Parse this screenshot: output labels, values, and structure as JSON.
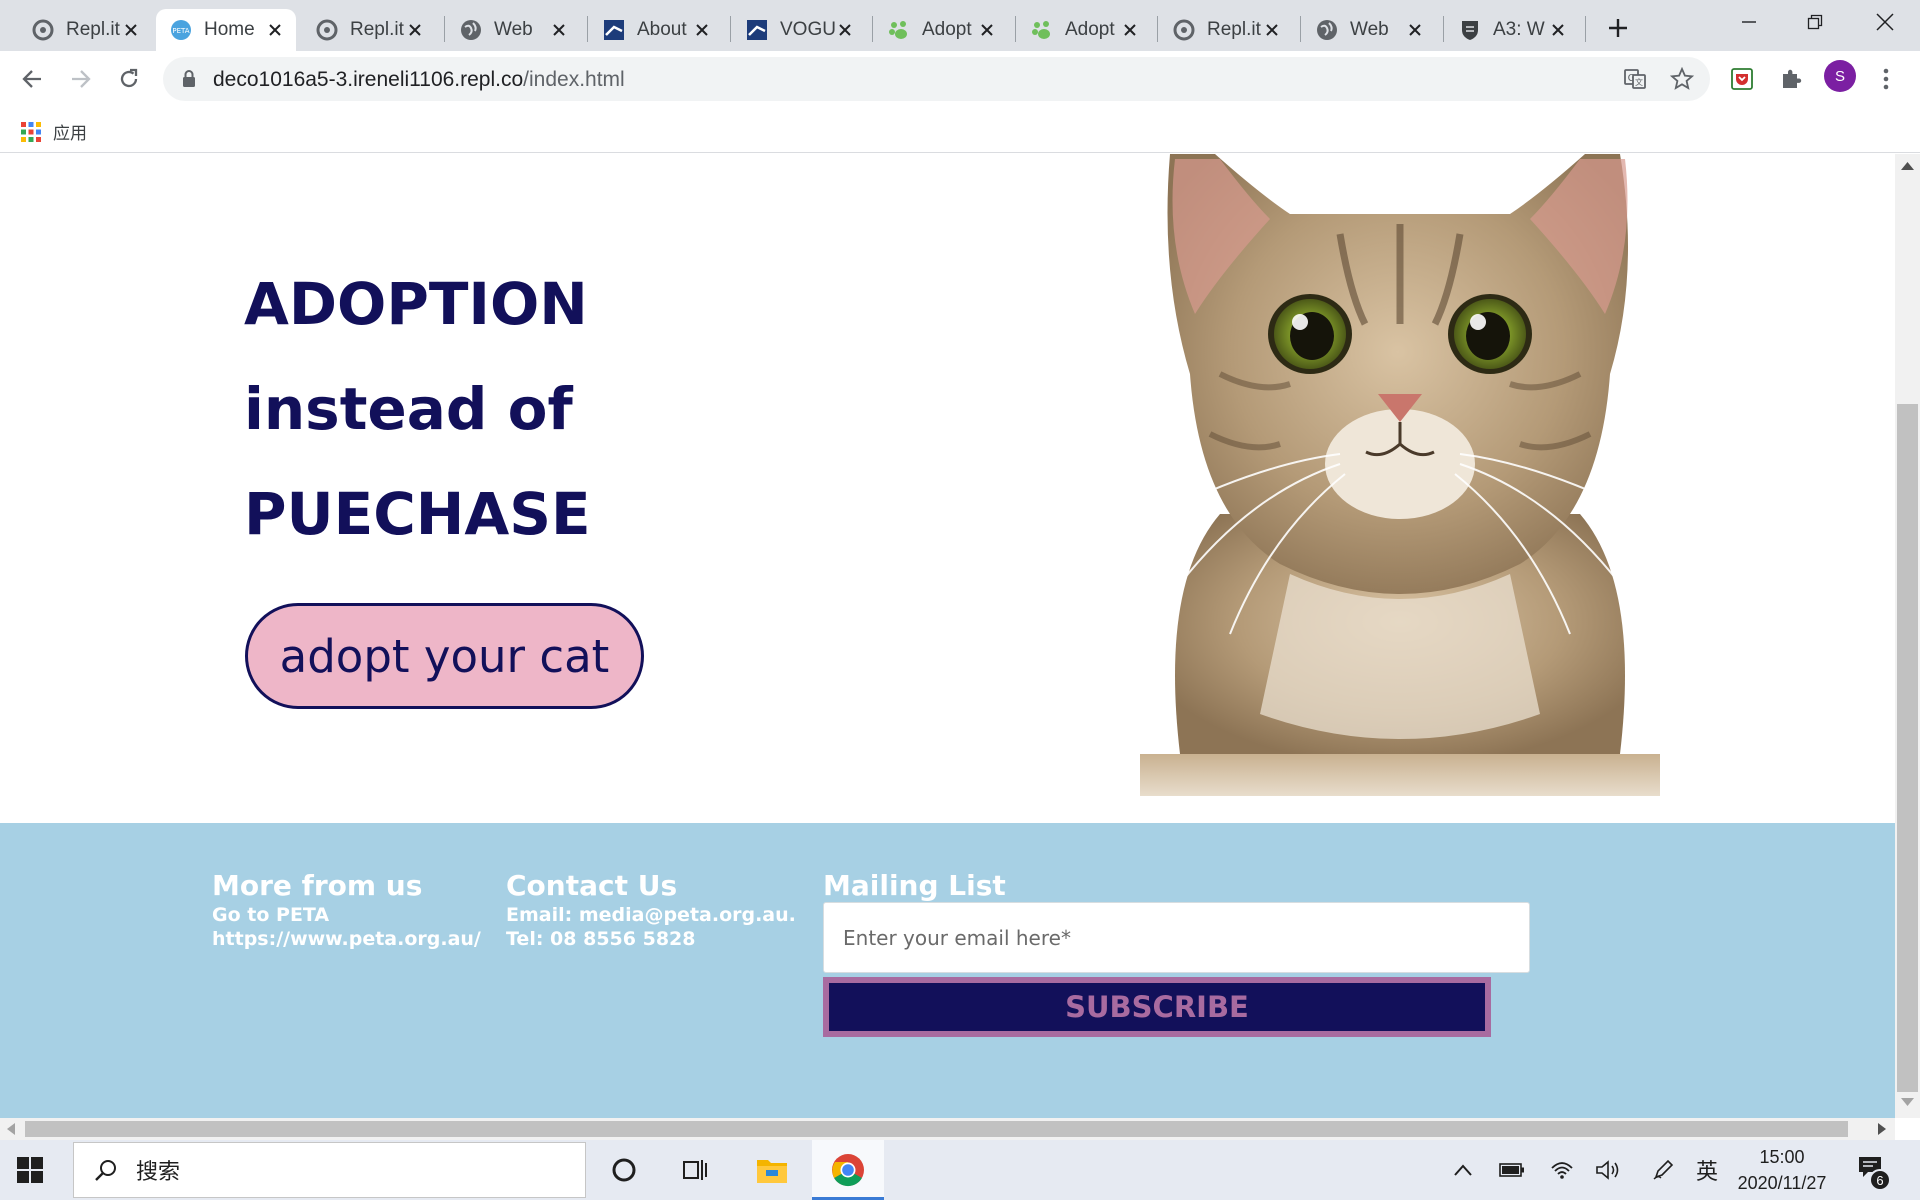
{
  "browser": {
    "tabs": [
      {
        "title": "Repl.it",
        "icon": "replit-icon"
      },
      {
        "title": "Home",
        "icon": "peta-icon",
        "active": true
      },
      {
        "title": "Repl.it",
        "icon": "replit-icon"
      },
      {
        "title": "Web",
        "icon": "globe-icon"
      },
      {
        "title": "About",
        "icon": "flag-icon"
      },
      {
        "title": "VOGUE",
        "icon": "flag-icon"
      },
      {
        "title": "Adopt",
        "icon": "paw-icon"
      },
      {
        "title": "Adopt",
        "icon": "paw-icon"
      },
      {
        "title": "Repl.it",
        "icon": "replit-icon"
      },
      {
        "title": "Web",
        "icon": "globe-icon"
      },
      {
        "title": "A3: W",
        "icon": "crest-icon"
      }
    ],
    "url_host": "deco1016a5-3.ireneli1106.repl.co",
    "url_path": "/index.html",
    "profile_initial": "S",
    "bookmark_apps_label": "应用"
  },
  "page": {
    "hero": {
      "line1": "ADOPTION",
      "line2": "instead of",
      "line3": "PUECHASE",
      "button": "adopt your cat"
    },
    "footer": {
      "more": {
        "heading": "More from us",
        "line1": "Go to PETA",
        "line2": "https://www.peta.org.au/"
      },
      "contact": {
        "heading": "Contact Us",
        "line1": "Email: media@peta.org.au.",
        "line2": "Tel: 08 8556 5828"
      },
      "mailing": {
        "heading": "Mailing List",
        "placeholder": "Enter your email here*",
        "button": "SUBSCRIBE"
      }
    }
  },
  "taskbar": {
    "search_label": "搜索",
    "ime": "英",
    "time": "15:00",
    "date": "2020/11/27",
    "notification_count": "6"
  },
  "colors": {
    "navy": "#12105a",
    "pink": "#eeb6c8",
    "footer_blue": "#a7d0e4",
    "subscribe_border": "#a86ba0"
  }
}
